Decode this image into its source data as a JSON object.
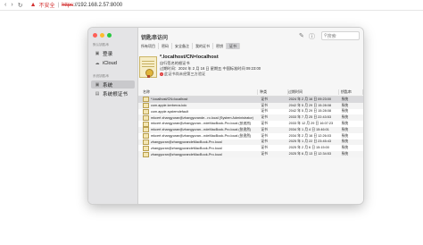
{
  "browser": {
    "back_icon": "chevron-left-icon",
    "forward_icon": "chevron-right-icon",
    "refresh_icon": "reload-icon",
    "warning_icon": "warning-triangle-icon",
    "insecure_label": "不安全",
    "separator": "|",
    "url_scheme": "https",
    "url_rest": "://192.168.2.57:8000"
  },
  "window": {
    "title": "钥匙串访问",
    "toolbar_icons": [
      "edit-icon",
      "info-icon"
    ],
    "search_placeholder": "搜索",
    "tabs": [
      {
        "label": "所有项目",
        "active": false
      },
      {
        "label": "密码",
        "active": false
      },
      {
        "label": "安全备注",
        "active": false
      },
      {
        "label": "我的证书",
        "active": false
      },
      {
        "label": "密钥",
        "active": false
      },
      {
        "label": "证书",
        "active": true
      }
    ]
  },
  "sidebar": {
    "sections": [
      {
        "title": "默认钥匙串",
        "items": [
          {
            "label": "登录",
            "icon": "lock-icon",
            "selected": false
          },
          {
            "label": "iCloud",
            "icon": "cloud-icon",
            "selected": false
          }
        ]
      },
      {
        "title": "系统钥匙串",
        "items": [
          {
            "label": "系统",
            "icon": "lock-icon",
            "selected": true
          },
          {
            "label": "系统根证书",
            "icon": "folder-icon",
            "selected": false
          }
        ]
      }
    ]
  },
  "cert_detail": {
    "icon": "certificate-icon",
    "name": "*.localhost/CN=localhost",
    "issuer": "自行签名的根证书",
    "expires": "过期时间：2024 年 2 月 16 日 星期五 中国标准时间 09:23:00",
    "trust_icon": "error-badge-icon",
    "trust": "此证书尚未经第三方验证"
  },
  "table": {
    "columns": [
      "名称",
      "种类",
      "过期时间",
      "钥匙串"
    ],
    "rows": [
      {
        "name": "*.localhost/CN=localhost",
        "kind": "证书",
        "expires": "2024 年 2 月 16 日 09:23:00",
        "keychain": "系统",
        "icon": "certificate-icon",
        "selected": true
      },
      {
        "name": "com.apple.kerberos.kdc",
        "kind": "证书",
        "expires": "2042 年 5 月 29 日 15:28:08",
        "keychain": "系统",
        "icon": "certificate-icon",
        "selected": false
      },
      {
        "name": "com.apple.systemdefault",
        "kind": "证书",
        "expires": "2042 年 5 月 29 日 15:28:08",
        "keychain": "系统",
        "icon": "certificate-icon",
        "selected": false
      },
      {
        "name": "mkcert zhangyuran@zhangyurande...ro.local (System Administrator)",
        "kind": "证书",
        "expires": "2033 年 7 月 25 日 22:43:53",
        "keychain": "系统",
        "icon": "certificate-icon",
        "selected": false
      },
      {
        "name": "mkcert zhangyuran@zhangyuran...ndeMacBook-Pro.local (张渔然)",
        "kind": "证书",
        "expires": "2033 年 12 月 29 日 16:07:23",
        "keychain": "系统",
        "icon": "certificate-icon",
        "selected": false
      },
      {
        "name": "mkcert zhangyuran@zhangyuran...ndeMacBook-Pro.local (张渔然)",
        "kind": "证书",
        "expires": "2034 年 1 月 4 日 15:46:01",
        "keychain": "系统",
        "icon": "certificate-icon",
        "selected": false
      },
      {
        "name": "mkcert zhangyuran@zhangyuran...ndeMacBook-Pro.local (张渔然)",
        "kind": "证书",
        "expires": "2034 年 2 月 16 日 12:26:03",
        "keychain": "系统",
        "icon": "certificate-icon",
        "selected": false
      },
      {
        "name": "zhangyuran@zhangyurandeMacBook-Pro.local",
        "kind": "证书",
        "expires": "2025 年 1 月 22 日 23:45:43",
        "keychain": "系统",
        "icon": "certificate-icon",
        "selected": false
      },
      {
        "name": "zhangyuran@zhangyurandeMacBook-Pro.local",
        "kind": "证书",
        "expires": "2025 年 2 月 6 日 15:15:00",
        "keychain": "系统",
        "icon": "certificate-icon",
        "selected": false
      },
      {
        "name": "zhangyuran@zhangyurandeMacBook-Pro.local",
        "kind": "证书",
        "expires": "2025 年 6 月 13 日 12:34:53",
        "keychain": "系统",
        "icon": "certificate-icon",
        "selected": false
      }
    ]
  }
}
